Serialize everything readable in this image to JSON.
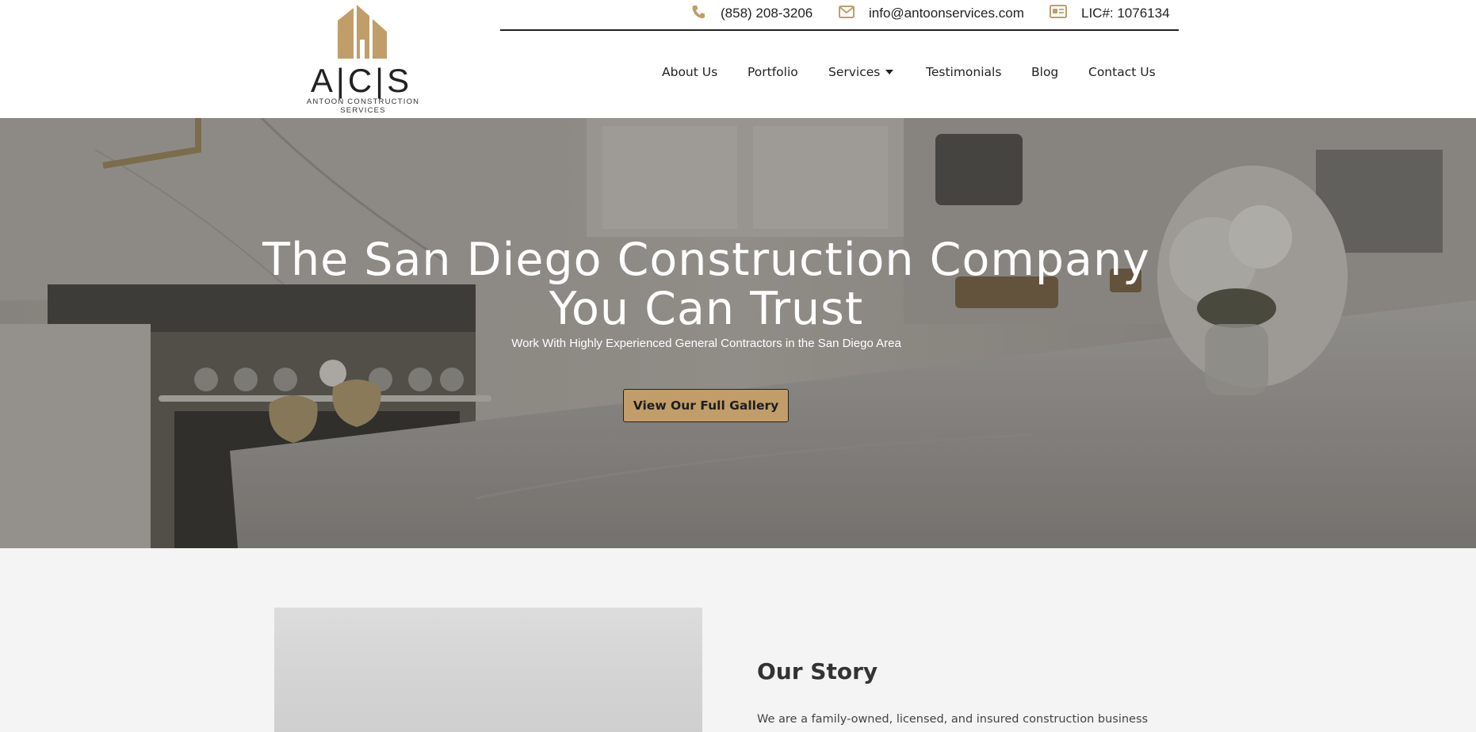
{
  "logo": {
    "letters": "A|C|S",
    "tagline": "ANTOON CONSTRUCTION SERVICES"
  },
  "contact": {
    "phone": "(858) 208-3206",
    "email": "info@antoonservices.com",
    "license": "LIC#: 1076134"
  },
  "nav": {
    "items": [
      {
        "label": "About Us"
      },
      {
        "label": "Portfolio"
      },
      {
        "label": "Services"
      },
      {
        "label": "Testimonials"
      },
      {
        "label": "Blog"
      },
      {
        "label": "Contact Us"
      }
    ]
  },
  "hero": {
    "title_line1": "The San Diego Construction Company",
    "title_line2": "You Can Trust",
    "subtitle": "Work With Highly Experienced General Contractors in the San Diego Area",
    "button_label": "View Our Full Gallery"
  },
  "story": {
    "title": "Our Story",
    "text": "We are a family-owned, licensed, and insured construction business"
  },
  "colors": {
    "accent": "#c19d6a",
    "header_bg": "#ffffff",
    "section_bg": "#f4f4f4",
    "text_dark": "#222222"
  },
  "icons": {
    "phone": "phone-icon",
    "email": "envelope-icon",
    "license": "id-card-icon",
    "dropdown": "caret-down-icon"
  }
}
